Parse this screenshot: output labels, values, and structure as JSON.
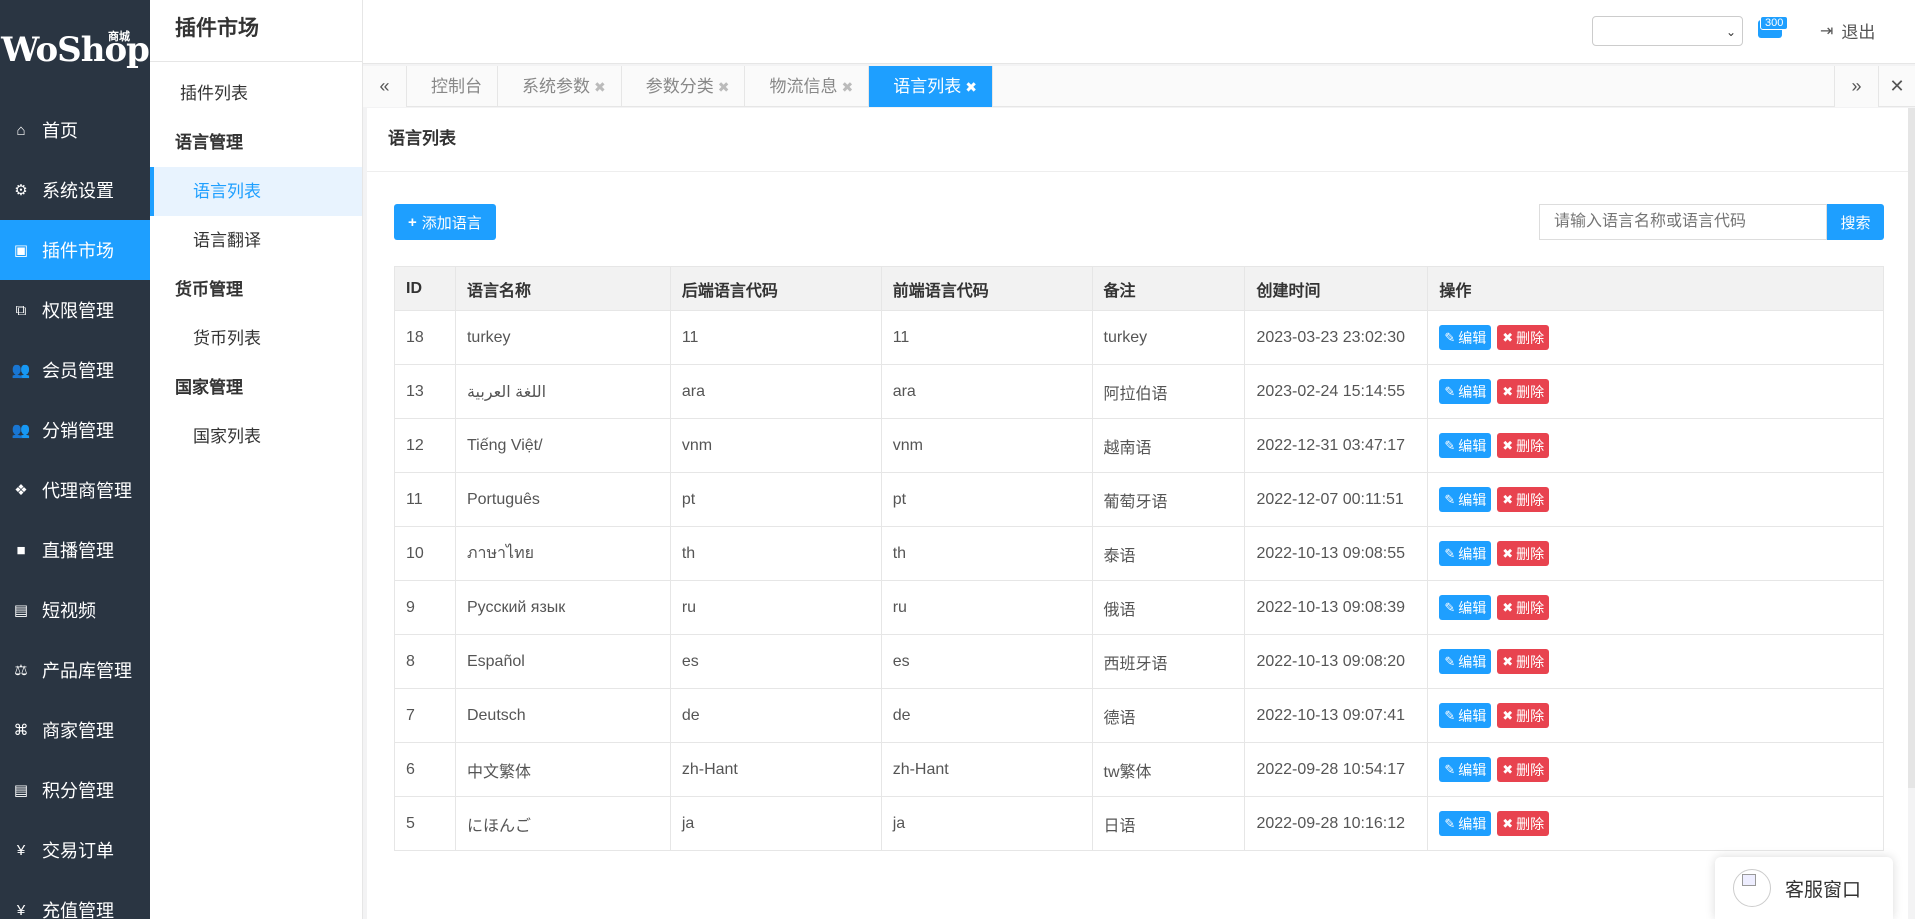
{
  "brand": {
    "logo_text": "WoShop",
    "logo_sub": "商城"
  },
  "leftnav": {
    "items": [
      {
        "label": "首页",
        "icon": "home-icon",
        "glyph": "⌂"
      },
      {
        "label": "系统设置",
        "icon": "gear-icon",
        "glyph": "⚙"
      },
      {
        "label": "插件市场",
        "icon": "plugin-icon",
        "glyph": "▣",
        "active": true
      },
      {
        "label": "权限管理",
        "icon": "sitemap-icon",
        "glyph": "⧉"
      },
      {
        "label": "会员管理",
        "icon": "users-icon",
        "glyph": "👥"
      },
      {
        "label": "分销管理",
        "icon": "users-icon",
        "glyph": "👥"
      },
      {
        "label": "代理商管理",
        "icon": "cubes-icon",
        "glyph": "❖"
      },
      {
        "label": "直播管理",
        "icon": "video-camera-icon",
        "glyph": "■"
      },
      {
        "label": "短视频",
        "icon": "file-video-icon",
        "glyph": "▤"
      },
      {
        "label": "产品库管理",
        "icon": "balance-scale-icon",
        "glyph": "⚖"
      },
      {
        "label": "商家管理",
        "icon": "bank-icon",
        "glyph": "⌘"
      },
      {
        "label": "积分管理",
        "icon": "file-points-icon",
        "glyph": "▤"
      },
      {
        "label": "交易订单",
        "icon": "currency-icon",
        "glyph": "¥"
      },
      {
        "label": "充值管理",
        "icon": "yen-icon",
        "glyph": "¥"
      }
    ]
  },
  "submenu": {
    "title": "插件市场",
    "plugin_list": "插件列表",
    "groups": [
      {
        "title": "语言管理",
        "items": [
          {
            "label": "语言列表",
            "active": true
          },
          {
            "label": "语言翻译"
          }
        ]
      },
      {
        "title": "货币管理",
        "items": [
          {
            "label": "货币列表"
          }
        ]
      },
      {
        "title": "国家管理",
        "items": [
          {
            "label": "国家列表"
          }
        ]
      }
    ]
  },
  "header": {
    "message_badge": "300",
    "logout_label": "退出",
    "lang_select_value": ""
  },
  "tabs": [
    {
      "label": "控制台",
      "closable": false
    },
    {
      "label": "系统参数",
      "closable": true
    },
    {
      "label": "参数分类",
      "closable": true
    },
    {
      "label": "物流信息",
      "closable": true
    },
    {
      "label": "语言列表",
      "closable": true,
      "active": true
    }
  ],
  "page": {
    "title": "语言列表",
    "add_button": "添加语言",
    "search_placeholder": "请输入语言名称或语言代码",
    "search_button": "搜索"
  },
  "table": {
    "columns": [
      "ID",
      "语言名称",
      "后端语言代码",
      "前端语言代码",
      "备注",
      "创建时间",
      "操作"
    ],
    "edit_label": "编辑",
    "delete_label": "删除",
    "rows": [
      {
        "id": "18",
        "name": "turkey",
        "backend": "11",
        "frontend": "11",
        "remark": "turkey",
        "created": "2023-03-23 23:02:30"
      },
      {
        "id": "13",
        "name": "اللغة العربية",
        "backend": "ara",
        "frontend": "ara",
        "remark": "阿拉伯语",
        "created": "2023-02-24 15:14:55"
      },
      {
        "id": "12",
        "name": "Tiếng Việt/",
        "backend": "vnm",
        "frontend": "vnm",
        "remark": "越南语",
        "created": "2022-12-31 03:47:17"
      },
      {
        "id": "11",
        "name": "Português",
        "backend": "pt",
        "frontend": "pt",
        "remark": "葡萄牙语",
        "created": "2022-12-07 00:11:51"
      },
      {
        "id": "10",
        "name": "ภาษาไทย",
        "backend": "th",
        "frontend": "th",
        "remark": "泰语",
        "created": "2022-10-13 09:08:55"
      },
      {
        "id": "9",
        "name": "Русский язык",
        "backend": "ru",
        "frontend": "ru",
        "remark": "俄语",
        "created": "2022-10-13 09:08:39"
      },
      {
        "id": "8",
        "name": "Español",
        "backend": "es",
        "frontend": "es",
        "remark": "西班牙语",
        "created": "2022-10-13 09:08:20"
      },
      {
        "id": "7",
        "name": "Deutsch",
        "backend": "de",
        "frontend": "de",
        "remark": "德语",
        "created": "2022-10-13 09:07:41"
      },
      {
        "id": "6",
        "name": "中文繁体",
        "backend": "zh-Hant",
        "frontend": "zh-Hant",
        "remark": "tw繁体",
        "created": "2022-09-28 10:54:17"
      },
      {
        "id": "5",
        "name": "にほんご",
        "backend": "ja",
        "frontend": "ja",
        "remark": "日语",
        "created": "2022-09-28 10:16:12"
      }
    ]
  },
  "customer_service": {
    "label": "客服窗口"
  },
  "colors": {
    "primary": "#1e9fff",
    "nav_bg": "#2a3542",
    "danger": "#e8434f"
  }
}
